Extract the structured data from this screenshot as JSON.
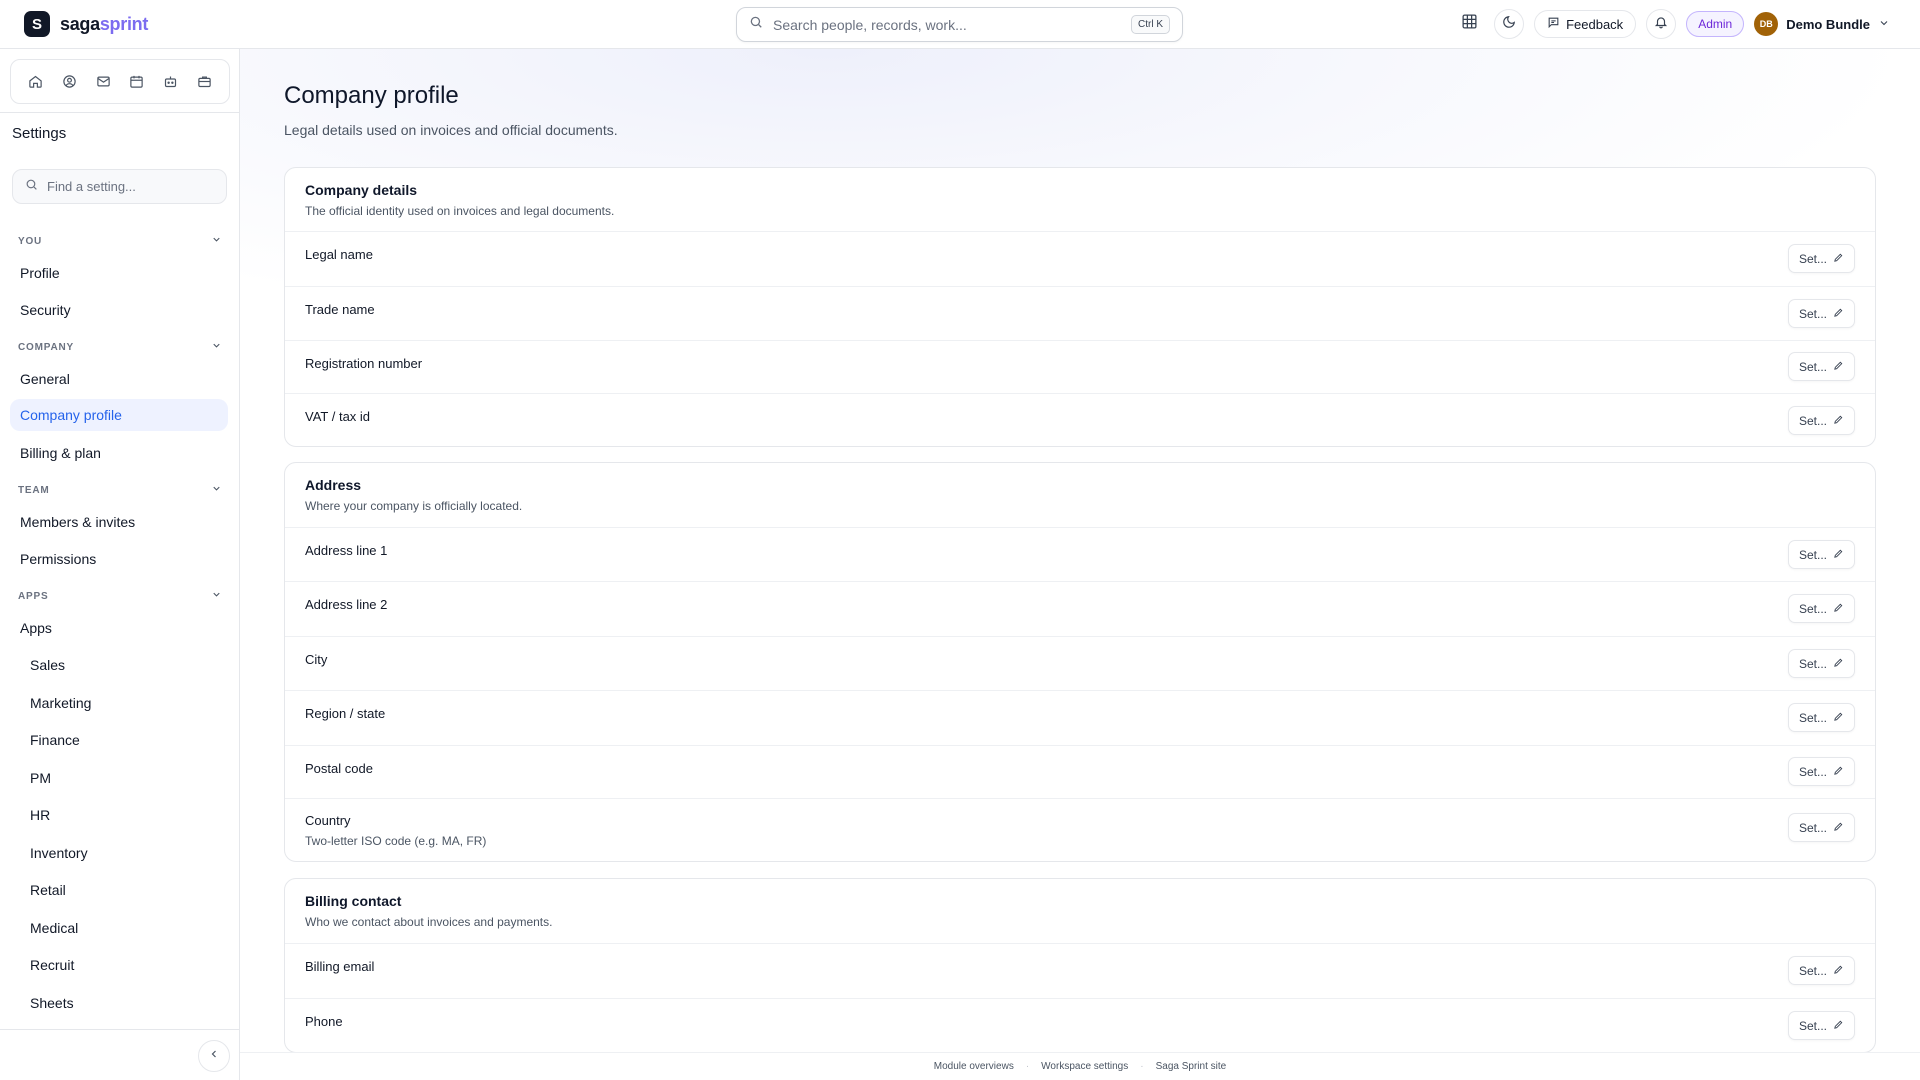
{
  "brand": {
    "logo_letter": "S",
    "name_part1": "saga",
    "name_part2": "sprint"
  },
  "search": {
    "placeholder": "Search people, records, work...",
    "shortcut": "Ctrl K"
  },
  "topbar": {
    "feedback_label": "Feedback",
    "role_badge": "Admin",
    "user_initials": "DB",
    "user_name": "Demo Bundle"
  },
  "sidebar": {
    "title": "Settings",
    "search_placeholder": "Find a setting...",
    "sections": {
      "you": "YOU",
      "company": "COMPANY",
      "team": "TEAM",
      "apps": "APPS"
    },
    "items": {
      "profile": "Profile",
      "security": "Security",
      "general": "General",
      "company_profile": "Company profile",
      "billing": "Billing & plan",
      "members": "Members & invites",
      "permissions": "Permissions",
      "apps": "Apps",
      "sales": "Sales",
      "marketing": "Marketing",
      "finance": "Finance",
      "pm": "PM",
      "hr": "HR",
      "inventory": "Inventory",
      "retail": "Retail",
      "medical": "Medical",
      "recruit": "Recruit",
      "sheets": "Sheets"
    }
  },
  "page": {
    "title": "Company profile",
    "subtitle": "Legal details used on invoices and official documents."
  },
  "set_label": "Set...",
  "cards": {
    "company": {
      "title": "Company details",
      "desc": "The official identity used on invoices and legal documents.",
      "rows": [
        "Legal name",
        "Trade name",
        "Registration number",
        "VAT / tax id"
      ]
    },
    "address": {
      "title": "Address",
      "desc": "Where your company is officially located.",
      "rows": [
        "Address line 1",
        "Address line 2",
        "City",
        "Region / state",
        "Postal code",
        "Country"
      ],
      "country_hint": "Two-letter ISO code (e.g. MA, FR)"
    },
    "billing": {
      "title": "Billing contact",
      "desc": "Who we contact about invoices and payments.",
      "rows": [
        "Billing email",
        "Phone"
      ]
    }
  },
  "footer": {
    "link1": "Module overviews",
    "link2": "Workspace settings",
    "link3": "Saga Sprint site"
  }
}
